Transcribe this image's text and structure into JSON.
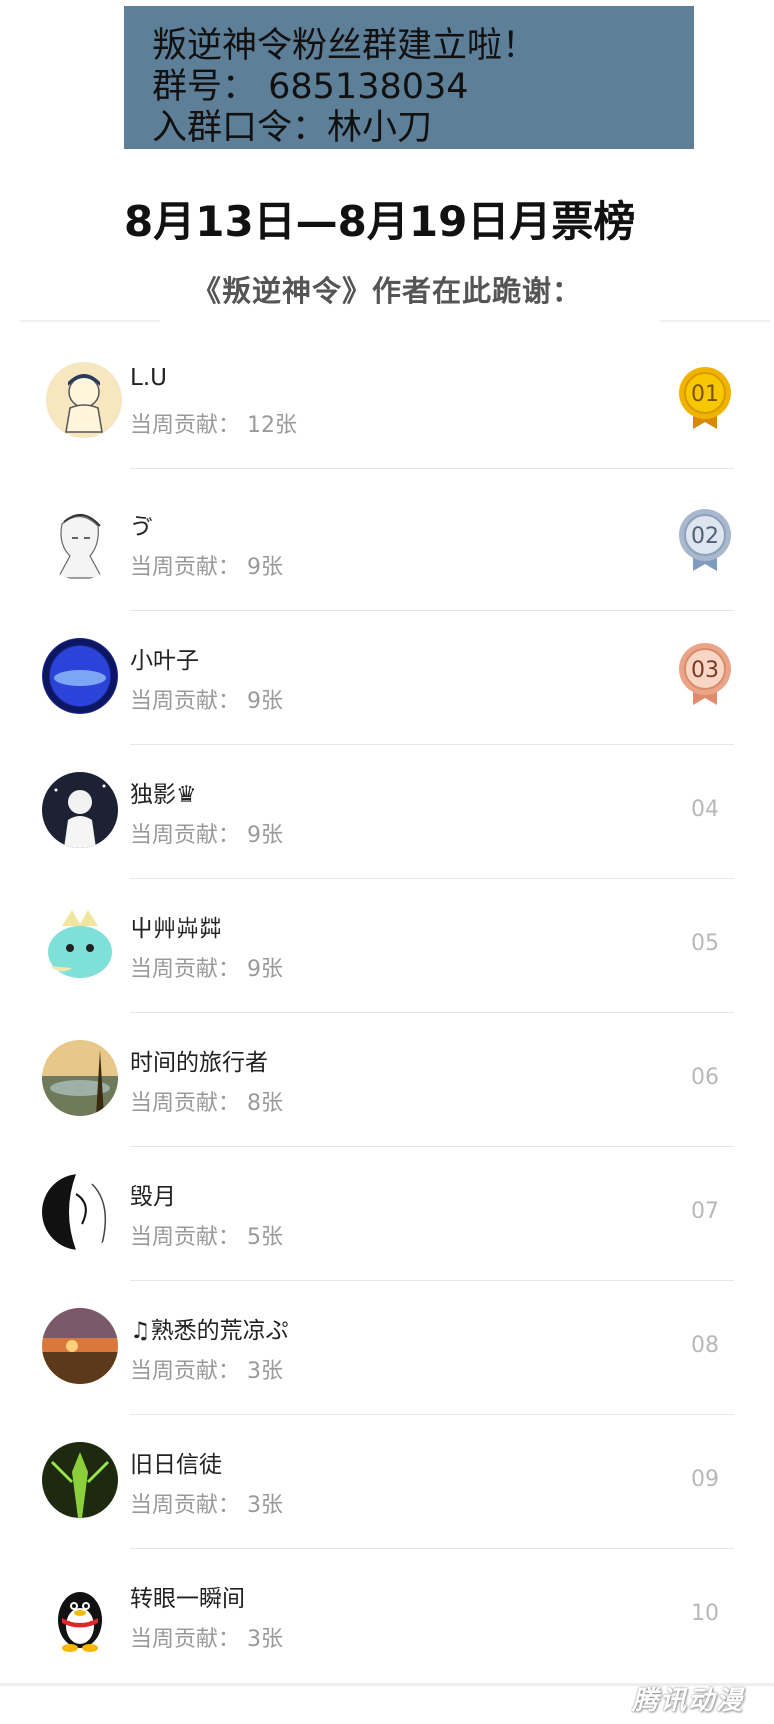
{
  "banner": {
    "line1": "叛逆神令粉丝群建立啦！",
    "line2": "群号：  685138034",
    "line3": "入群口令：林小刀"
  },
  "title": "8月13日—8月19日月票榜",
  "subtitle": "《叛逆神令》作者在此跪谢：",
  "contribution_label": "当周贡献：",
  "entries": [
    {
      "rank": "01",
      "name": "L.U",
      "contribution": "当周贡献：  12张",
      "medal": "gold"
    },
    {
      "rank": "02",
      "name": "ゔ",
      "contribution": "当周贡献：  9张",
      "medal": "silver"
    },
    {
      "rank": "03",
      "name": "小叶子",
      "contribution": "当周贡献：  9张",
      "medal": "bronze"
    },
    {
      "rank": "04",
      "name": "独影♛",
      "contribution": "当周贡献：  9张",
      "medal": ""
    },
    {
      "rank": "05",
      "name": "屮艸芔茻",
      "contribution": "当周贡献：  9张",
      "medal": ""
    },
    {
      "rank": "06",
      "name": "时间的旅行者",
      "contribution": "当周贡献：  8张",
      "medal": ""
    },
    {
      "rank": "07",
      "name": "毁月",
      "contribution": "当周贡献：  5张",
      "medal": ""
    },
    {
      "rank": "08",
      "name": "♫熟悉的荒凉ぷ",
      "contribution": "当周贡献：  3张",
      "medal": ""
    },
    {
      "rank": "09",
      "name": "旧日信徒",
      "contribution": "当周贡献：  3张",
      "medal": ""
    },
    {
      "rank": "10",
      "name": "转眼一瞬间",
      "contribution": "当周贡献：  3张",
      "medal": ""
    }
  ],
  "watermark": "腾讯动漫",
  "colors": {
    "banner": "#5e7f98",
    "gold": "#f0b400",
    "silver": "#a9b8cc",
    "bronze": "#e9a489"
  }
}
